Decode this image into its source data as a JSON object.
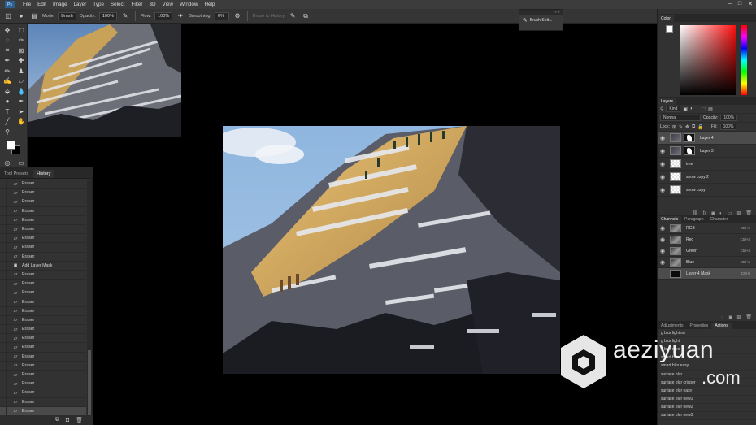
{
  "menubar": {
    "logo": "Ps",
    "items": [
      "File",
      "Edit",
      "Image",
      "Layer",
      "Type",
      "Select",
      "Filter",
      "3D",
      "View",
      "Window",
      "Help"
    ]
  },
  "options": {
    "mode_label": "Mode:",
    "mode_value": "Brush",
    "opacity_label": "Opacity:",
    "opacity_value": "100%",
    "flow_label": "Flow:",
    "flow_value": "100%",
    "smoothing_label": "Smoothing:",
    "smoothing_value": "0%",
    "erase_history_label": "Erase to History"
  },
  "brush_settings": {
    "label": "Brush Sett..."
  },
  "history_panel": {
    "tabs": [
      "Tool Presets",
      "History"
    ],
    "items": [
      {
        "label": "Eraser",
        "icon": "eraser-icon"
      },
      {
        "label": "Eraser",
        "icon": "eraser-icon"
      },
      {
        "label": "Eraser",
        "icon": "eraser-icon"
      },
      {
        "label": "Eraser",
        "icon": "eraser-icon"
      },
      {
        "label": "Eraser",
        "icon": "eraser-icon"
      },
      {
        "label": "Eraser",
        "icon": "eraser-icon"
      },
      {
        "label": "Eraser",
        "icon": "eraser-icon"
      },
      {
        "label": "Eraser",
        "icon": "eraser-icon"
      },
      {
        "label": "Eraser",
        "icon": "eraser-icon"
      },
      {
        "label": "Add Layer Mask",
        "icon": "layer-mask-icon"
      },
      {
        "label": "Eraser",
        "icon": "eraser-icon"
      },
      {
        "label": "Eraser",
        "icon": "eraser-icon"
      },
      {
        "label": "Eraser",
        "icon": "eraser-icon"
      },
      {
        "label": "Eraser",
        "icon": "eraser-icon"
      },
      {
        "label": "Eraser",
        "icon": "eraser-icon"
      },
      {
        "label": "Eraser",
        "icon": "eraser-icon"
      },
      {
        "label": "Eraser",
        "icon": "eraser-icon"
      },
      {
        "label": "Eraser",
        "icon": "eraser-icon"
      },
      {
        "label": "Eraser",
        "icon": "eraser-icon"
      },
      {
        "label": "Eraser",
        "icon": "eraser-icon"
      },
      {
        "label": "Eraser",
        "icon": "eraser-icon"
      },
      {
        "label": "Eraser",
        "icon": "eraser-icon"
      },
      {
        "label": "Eraser",
        "icon": "eraser-icon"
      },
      {
        "label": "Eraser",
        "icon": "eraser-icon"
      },
      {
        "label": "Eraser",
        "icon": "eraser-icon"
      },
      {
        "label": "Eraser",
        "icon": "eraser-icon"
      }
    ],
    "selected_index": 25
  },
  "color_panel": {
    "tab": "Color"
  },
  "layers_panel": {
    "tab": "Layers",
    "kind_label": "Kind",
    "blend_mode": "Normal",
    "opacity_label": "Opacity:",
    "opacity_value": "100%",
    "lock_label": "Lock:",
    "fill_label": "Fill:",
    "fill_value": "100%",
    "layers": [
      {
        "name": "Layer 4",
        "thumb": "dark",
        "mask": true,
        "selected": true
      },
      {
        "name": "Layer 3",
        "thumb": "dark",
        "mask": true,
        "selected": false
      },
      {
        "name": "tree",
        "thumb": "checker",
        "mask": false,
        "selected": false
      },
      {
        "name": "snow copy 2",
        "thumb": "checker",
        "mask": false,
        "selected": false
      },
      {
        "name": "snow copy",
        "thumb": "checker",
        "mask": false,
        "selected": false
      }
    ]
  },
  "channels_panel": {
    "tabs": [
      "Channels",
      "Paragraph",
      "Character"
    ],
    "channels": [
      {
        "name": "RGB",
        "key": "Ctrl+2",
        "mask": false
      },
      {
        "name": "Red",
        "key": "Ctrl+3",
        "mask": false
      },
      {
        "name": "Green",
        "key": "Ctrl+4",
        "mask": false
      },
      {
        "name": "Blue",
        "key": "Ctrl+5",
        "mask": false
      },
      {
        "name": "Layer 4 Mask",
        "key": "Ctrl+\\",
        "mask": true
      }
    ]
  },
  "actions_panel": {
    "tabs": [
      "Adjustments",
      "Properties",
      "Actions"
    ],
    "items": [
      "g blur lightest",
      "g blur light",
      "g blur med",
      "smart blur",
      "smart blur easy",
      "surface blur",
      "surface blur crisper",
      "surface blur easy",
      "surface blur new1",
      "surface blur new2",
      "surface blur new3"
    ]
  },
  "watermark": {
    "line1": "aeziyuan",
    "line2": ".com"
  }
}
